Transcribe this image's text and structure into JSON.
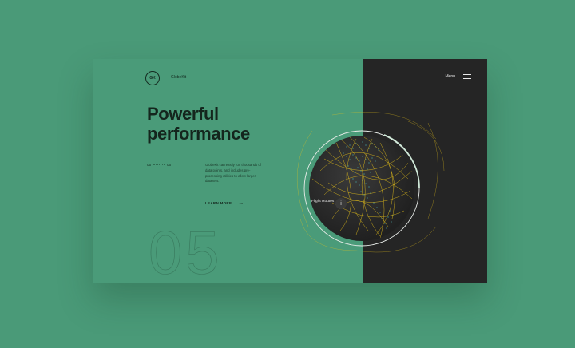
{
  "brand": {
    "logo_text": "GK",
    "name": "GlobeKit"
  },
  "hero": {
    "headline_line1": "Powerful",
    "headline_line2": "performance",
    "description": "GlobeKit can easily run thousands of data points, and includes pre-processing utilities to allow larger datasets.",
    "learn_more": "LEARN MORE",
    "arrow": "→",
    "big_number": "05"
  },
  "pager": {
    "current": "05",
    "total": "06"
  },
  "nav": {
    "menu_label": "Menu"
  },
  "globe_panel": {
    "caption": "Flight Routes",
    "info_icon_glyph": "i"
  },
  "colors": {
    "background": "#4a9a78",
    "dark_panel": "#252525",
    "route": "#e8c21a",
    "globe": "#2c2c2c",
    "text_dark": "#14261d"
  }
}
